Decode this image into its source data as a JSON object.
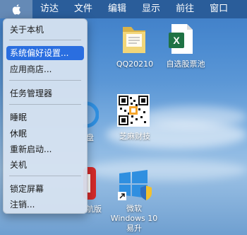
{
  "menubar": {
    "items": [
      "访达",
      "文件",
      "编辑",
      "显示",
      "前往",
      "窗口"
    ]
  },
  "apple_menu": {
    "items": [
      "关于本机",
      "系统偏好设置...",
      "应用商店...",
      "任务管理器",
      "睡眠",
      "休眠",
      "重新启动...",
      "关机",
      "锁定屏幕",
      "注销..."
    ],
    "highlighted": "系统偏好设置..."
  },
  "desktop": {
    "icons": [
      {
        "label": "QQ20210",
        "icon": "folder-icon"
      },
      {
        "label": "自选股票池",
        "icon": "excel-icon"
      },
      {
        "label": "芝麻财技",
        "icon": "qr-code-icon"
      },
      {
        "label": "微软\nWindows 10\n易升",
        "icon": "windows-icon"
      },
      {
        "label": "盘",
        "icon": "partial-icon"
      },
      {
        "label": "航版",
        "icon": "partial-icon"
      }
    ]
  },
  "colors": {
    "menubar": "#285a96",
    "highlight": "#2a6ee0",
    "excel": "#1f7244",
    "windows": "#2f8fe0"
  }
}
